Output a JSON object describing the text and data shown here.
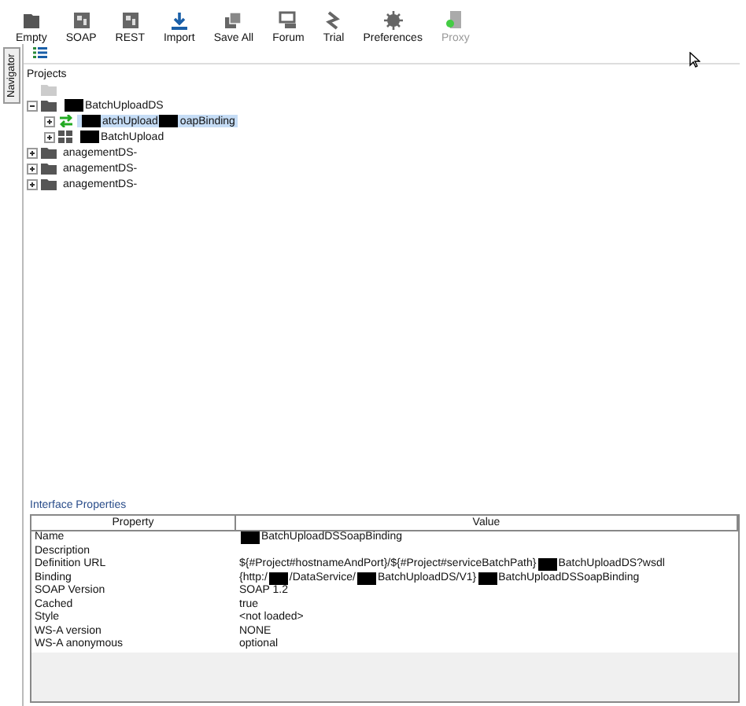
{
  "toolbar": [
    {
      "label": "Empty",
      "disabled": false
    },
    {
      "label": "SOAP",
      "disabled": false
    },
    {
      "label": "REST",
      "disabled": false
    },
    {
      "label": "Import",
      "disabled": false
    },
    {
      "label": "Save All",
      "disabled": false
    },
    {
      "label": "Forum",
      "disabled": false
    },
    {
      "label": "Trial",
      "disabled": false
    },
    {
      "label": "Preferences",
      "disabled": false
    },
    {
      "label": "Proxy",
      "disabled": true
    }
  ],
  "side_tab": "Navigator",
  "navigator": {
    "root": "Projects",
    "tree": [
      {
        "kind": "folder",
        "disabled": true
      },
      {
        "kind": "folder",
        "expanded": true,
        "disabled": false,
        "selected": false,
        "parts": [
          {
            "kind": "redacted"
          },
          {
            "kind": "text",
            "text": "BatchUploadDS"
          }
        ],
        "children": [
          {
            "kind": "interface",
            "expanded": false,
            "selected": true,
            "parts": [
              {
                "kind": "redacted"
              },
              {
                "kind": "text",
                "text": "atchUpload"
              },
              {
                "kind": "redacted"
              },
              {
                "kind": "text",
                "text": "oapBinding"
              }
            ]
          },
          {
            "kind": "suite",
            "expanded": false,
            "selected": false,
            "parts": [
              {
                "kind": "redacted"
              },
              {
                "kind": "text",
                "text": "BatchUpload"
              }
            ]
          }
        ]
      },
      {
        "kind": "folder",
        "expanded": false,
        "disabled": false,
        "selected": false,
        "parts": [
          {
            "kind": "text",
            "text": "anagementDS-"
          }
        ]
      },
      {
        "kind": "folder",
        "expanded": false,
        "disabled": false,
        "selected": false,
        "parts": [
          {
            "kind": "text",
            "text": "anagementDS-"
          }
        ]
      },
      {
        "kind": "folder",
        "expanded": false,
        "disabled": false,
        "selected": false,
        "parts": [
          {
            "kind": "text",
            "text": "anagementDS-"
          }
        ]
      }
    ]
  },
  "properties": {
    "title": "Interface Properties",
    "columns": [
      "Property",
      "Value"
    ],
    "rows": [
      {
        "name": "Name",
        "value": [
          {
            "kind": "redacted"
          },
          {
            "kind": "text",
            "text": "BatchUploadDSSoapBinding"
          }
        ]
      },
      {
        "name": "Description",
        "value": []
      },
      {
        "name": "Definition URL",
        "value": [
          {
            "kind": "text",
            "text": "${#Project#hostnameAndPort}/${#Project#serviceBatchPath}"
          },
          {
            "kind": "redacted"
          },
          {
            "kind": "text",
            "text": "BatchUploadDS?wsdl"
          }
        ]
      },
      {
        "name": "Binding",
        "value": [
          {
            "kind": "text",
            "text": "{http:/"
          },
          {
            "kind": "redacted"
          },
          {
            "kind": "text",
            "text": "/DataService/"
          },
          {
            "kind": "redacted"
          },
          {
            "kind": "text",
            "text": "BatchUploadDS/V1}"
          },
          {
            "kind": "redacted"
          },
          {
            "kind": "text",
            "text": "BatchUploadDSSoapBinding"
          }
        ]
      },
      {
        "name": "SOAP Version",
        "value": [
          {
            "kind": "text",
            "text": "SOAP 1.2"
          }
        ]
      },
      {
        "name": "Cached",
        "value": [
          {
            "kind": "text",
            "text": "true"
          }
        ]
      },
      {
        "name": "Style",
        "value": [
          {
            "kind": "text",
            "text": "<not loaded>"
          }
        ]
      },
      {
        "name": "WS-A version",
        "value": [
          {
            "kind": "text",
            "text": "NONE"
          }
        ]
      },
      {
        "name": "WS-A anonymous",
        "value": [
          {
            "kind": "text",
            "text": "optional"
          }
        ]
      }
    ]
  }
}
